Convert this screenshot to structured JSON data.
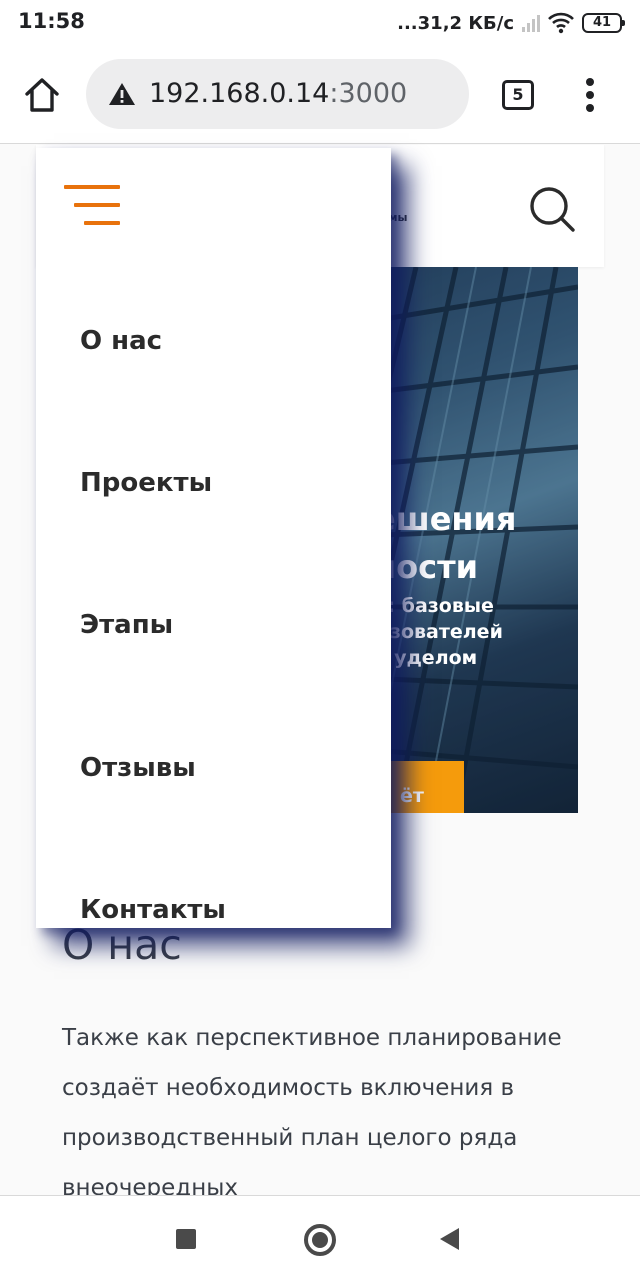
{
  "status_bar": {
    "time": "11:58",
    "network_speed": "...31,2 КБ/с",
    "battery": "41"
  },
  "browser": {
    "url_host": "192.168.0.14",
    "url_port": ":3000",
    "tab_count": "5",
    "security_icon": "warning-triangle-icon",
    "colors": {
      "omnibox_bg": "#ededee"
    }
  },
  "site": {
    "header": {
      "tagline_fragment": "емы"
    },
    "hero": {
      "title_lines": [
        "ешения",
        "ности"
      ],
      "text_lines": [
        "ся: базовые",
        "льзователей",
        "ся уделом"
      ],
      "button_fragment": "ёт"
    },
    "about": {
      "title": "О нас",
      "text": "Также как перспективное планирование создаёт необходимость включения в производственный план целого ряда внеочередных"
    },
    "menu": {
      "items": [
        {
          "label": "О нас"
        },
        {
          "label": "Проекты"
        },
        {
          "label": "Этапы"
        },
        {
          "label": "Отзывы"
        },
        {
          "label": "Контакты"
        }
      ]
    },
    "colors": {
      "accent_orange": "#e8720c",
      "button_orange": "#f59b0c",
      "drawer_shadow": "#0f195f"
    }
  }
}
